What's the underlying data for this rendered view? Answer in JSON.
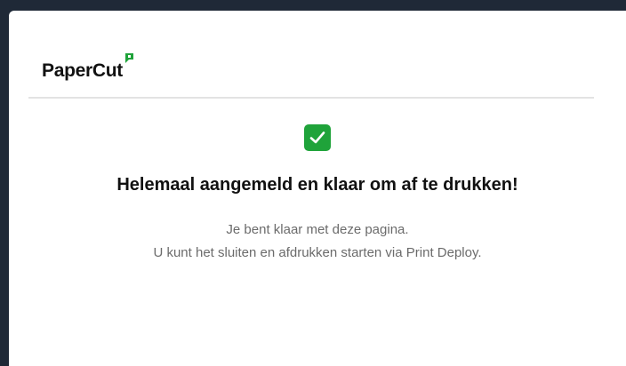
{
  "brand": {
    "name": "PaperCut",
    "accent_color": "#1fa33a"
  },
  "status": {
    "icon": "check-icon",
    "title": "Helemaal aangemeld en klaar om af te drukken!",
    "line1": "Je bent klaar met deze pagina.",
    "line2": "U kunt het sluiten en afdrukken starten via Print Deploy."
  }
}
